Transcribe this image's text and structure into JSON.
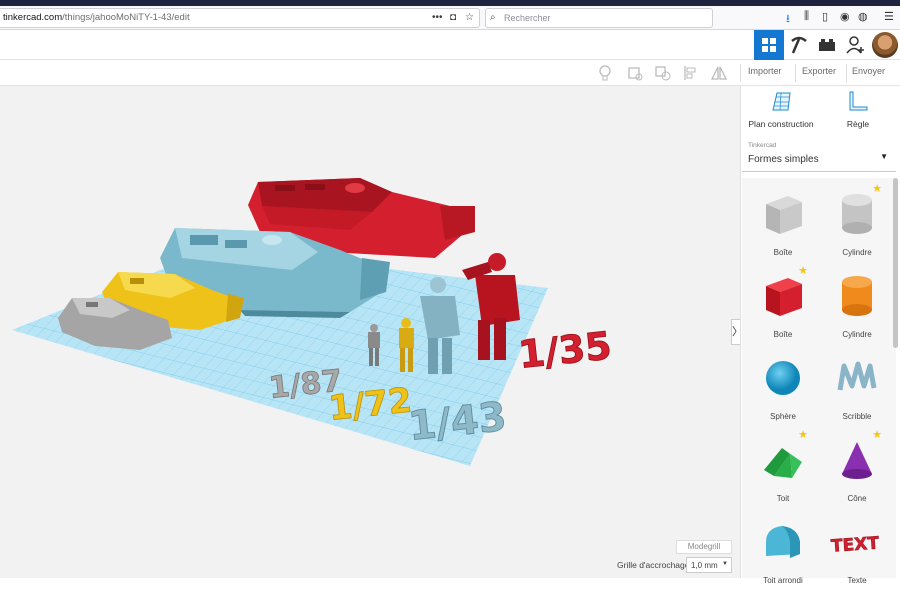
{
  "browser": {
    "url_host": "tinkercad.com",
    "url_path": "/things/jahooMoNiTY-1-43/edit",
    "search_placeholder": "Rechercher"
  },
  "toolbar": {
    "import_label": "Importer",
    "export_label": "Exporter",
    "send_label": "Envoyer"
  },
  "panel": {
    "tool_workplane_label": "Plan construction",
    "tool_ruler_label": "Règle",
    "library_caption": "Tinkercad",
    "library_selected": "Formes simples",
    "shapes": [
      {
        "label": "Boîte",
        "icon": "box-gray-icon",
        "starred": false
      },
      {
        "label": "Cylindre",
        "icon": "cylinder-gray-icon",
        "starred": true
      },
      {
        "label": "Boîte",
        "icon": "box-red-icon",
        "starred": true
      },
      {
        "label": "Cylindre",
        "icon": "cylinder-orange-icon",
        "starred": false
      },
      {
        "label": "Sphère",
        "icon": "sphere-blue-icon",
        "starred": false
      },
      {
        "label": "Scribble",
        "icon": "scribble-icon",
        "starred": false
      },
      {
        "label": "Toit",
        "icon": "roof-green-icon",
        "starred": true
      },
      {
        "label": "Cône",
        "icon": "cone-purple-icon",
        "starred": true
      },
      {
        "label": "Toit arrondi",
        "icon": "round-roof-icon",
        "starred": false
      },
      {
        "label": "Texte",
        "icon": "text-red-icon",
        "starred": false
      }
    ]
  },
  "workplane": {
    "modegrid_label": "Modegrill",
    "grid_label": "Grille d'accrochage",
    "grid_value": "1,0 mm",
    "scale_labels": [
      "1/87",
      "1/72",
      "1/43",
      "1/35"
    ]
  },
  "colors": {
    "accent": "#1477d1",
    "red_model": "#d4202e",
    "blue_model": "#7ab8cc",
    "yellow_model": "#efc21a",
    "gray_model": "#a5a5a5",
    "grid": "#8fd3ee"
  }
}
